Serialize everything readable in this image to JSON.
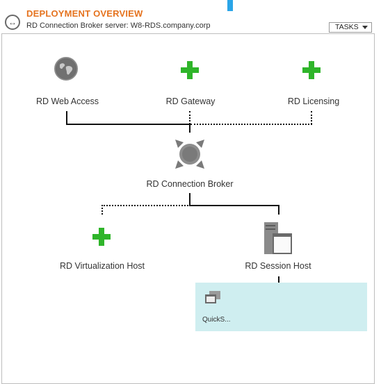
{
  "header": {
    "title": "DEPLOYMENT OVERVIEW",
    "subtitle": "RD Connection Broker server: W8-RDS.company.corp",
    "tasks_label": "TASKS"
  },
  "nodes": {
    "web_access": "RD Web Access",
    "gateway": "RD Gateway",
    "licensing": "RD Licensing",
    "broker": "RD Connection Broker",
    "virtualization_host": "RD Virtualization Host",
    "session_host": "RD Session Host"
  },
  "collection": {
    "label": "QuickS..."
  },
  "colors": {
    "accent_orange": "#e5731f",
    "install_green": "#2fb52a",
    "collection_bg": "#cfeef0"
  }
}
